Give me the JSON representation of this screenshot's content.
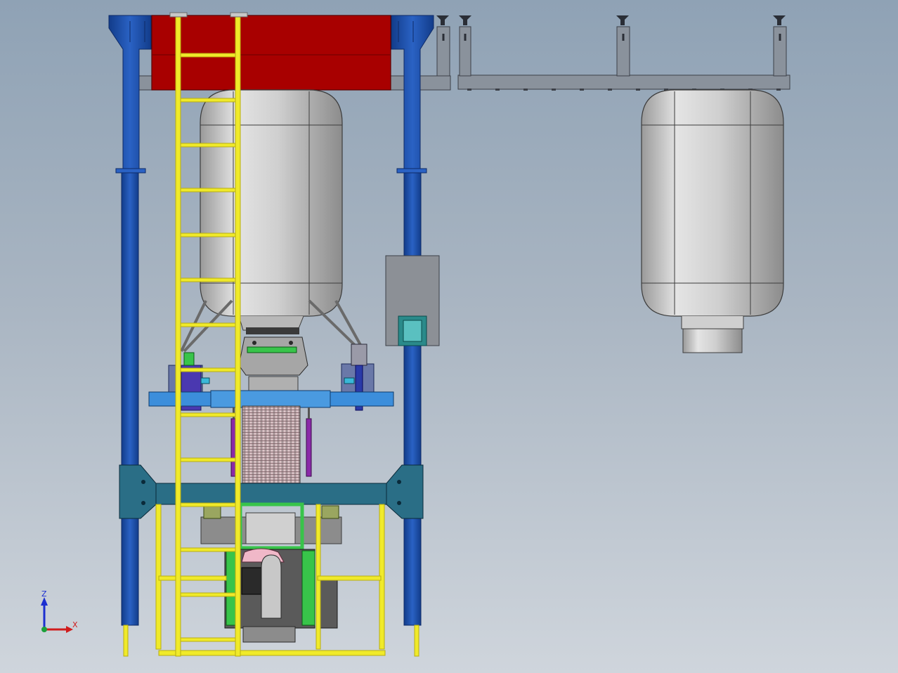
{
  "viewport": {
    "background_top": "#8fa2b5",
    "background_bottom": "#cfd5dc"
  },
  "triad": {
    "z_label": "Z",
    "x_label": "X",
    "z_color": "#1c2fd0",
    "x_color": "#d01c1c",
    "y_color": "#1ca03a"
  },
  "colors": {
    "column_blue": "#1e4fa8",
    "column_edge": "#0e2a66",
    "red_panel": "#a80000",
    "ladder_yellow": "#f0ea2a",
    "tank_silver": "#c8c8c8",
    "beam_gray": "#8a929c",
    "teal_beam": "#2a6e86",
    "platform_blue": "#3c8edb",
    "green_frame": "#38c44a",
    "purple_rod": "#8a2aa8",
    "pink_bellows": "#d9a8b0",
    "olive_mount": "#9aa660"
  }
}
